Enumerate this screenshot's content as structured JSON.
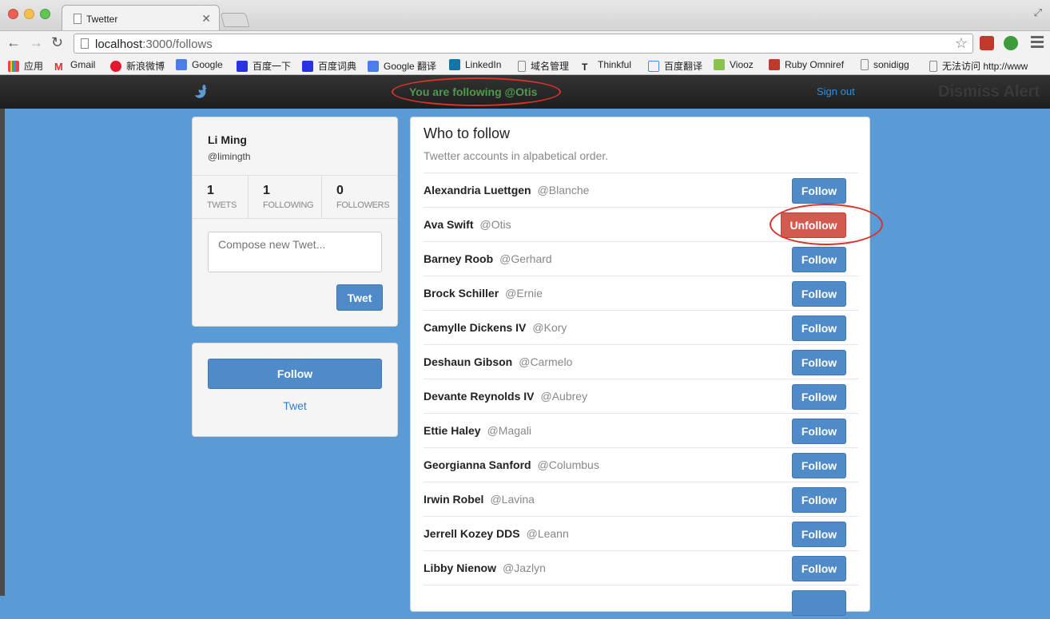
{
  "browser": {
    "tab_title": "Twetter",
    "url_host": "localhost",
    "url_path": ":3000/follows",
    "bookmarks": [
      "应用",
      "Gmail",
      "新浪微博",
      "Google",
      "百度一下",
      "百度词典",
      "Google 翻译",
      "LinkedIn",
      "域名管理",
      "Thinkful",
      "百度翻译",
      "Viooz",
      "Ruby Omniref",
      "sonidigg",
      "无法访问 http://www"
    ]
  },
  "navbar": {
    "alert": "You are following @Otis",
    "signout": "Sign out",
    "dismiss": "Dismiss Alert"
  },
  "profile": {
    "name": "Li Ming",
    "handle": "@limingth",
    "tweets_count": "1",
    "tweets_label": "TWETS",
    "following_count": "1",
    "following_label": "FOLLOWING",
    "followers_count": "0",
    "followers_label": "FOLLOWERS",
    "compose_placeholder": "Compose new Twet...",
    "tweet_button": "Twet"
  },
  "actions": {
    "follow_button": "Follow",
    "tweet_link": "Twet"
  },
  "who": {
    "title": "Who to follow",
    "subtitle": "Twetter accounts in alpabetical order.",
    "users": [
      {
        "name": "Alexandria Luettgen",
        "handle": "@Blanche",
        "button": "Follow"
      },
      {
        "name": "Ava Swift",
        "handle": "@Otis",
        "button": "Unfollow"
      },
      {
        "name": "Barney Roob",
        "handle": "@Gerhard",
        "button": "Follow"
      },
      {
        "name": "Brock Schiller",
        "handle": "@Ernie",
        "button": "Follow"
      },
      {
        "name": "Camylle Dickens IV",
        "handle": "@Kory",
        "button": "Follow"
      },
      {
        "name": "Deshaun Gibson",
        "handle": "@Carmelo",
        "button": "Follow"
      },
      {
        "name": "Devante Reynolds IV",
        "handle": "@Aubrey",
        "button": "Follow"
      },
      {
        "name": "Ettie Haley",
        "handle": "@Magali",
        "button": "Follow"
      },
      {
        "name": "Georgianna Sanford",
        "handle": "@Columbus",
        "button": "Follow"
      },
      {
        "name": "Irwin Robel",
        "handle": "@Lavina",
        "button": "Follow"
      },
      {
        "name": "Jerrell Kozey DDS",
        "handle": "@Leann",
        "button": "Follow"
      },
      {
        "name": "Libby Nienow",
        "handle": "@Jazlyn",
        "button": "Follow"
      }
    ]
  },
  "colors": {
    "follow_button": "#4f8ac9",
    "unfollow_button": "#d35a4f",
    "alert_text": "#4e9a4e",
    "annotation_ring": "#d9332a"
  }
}
